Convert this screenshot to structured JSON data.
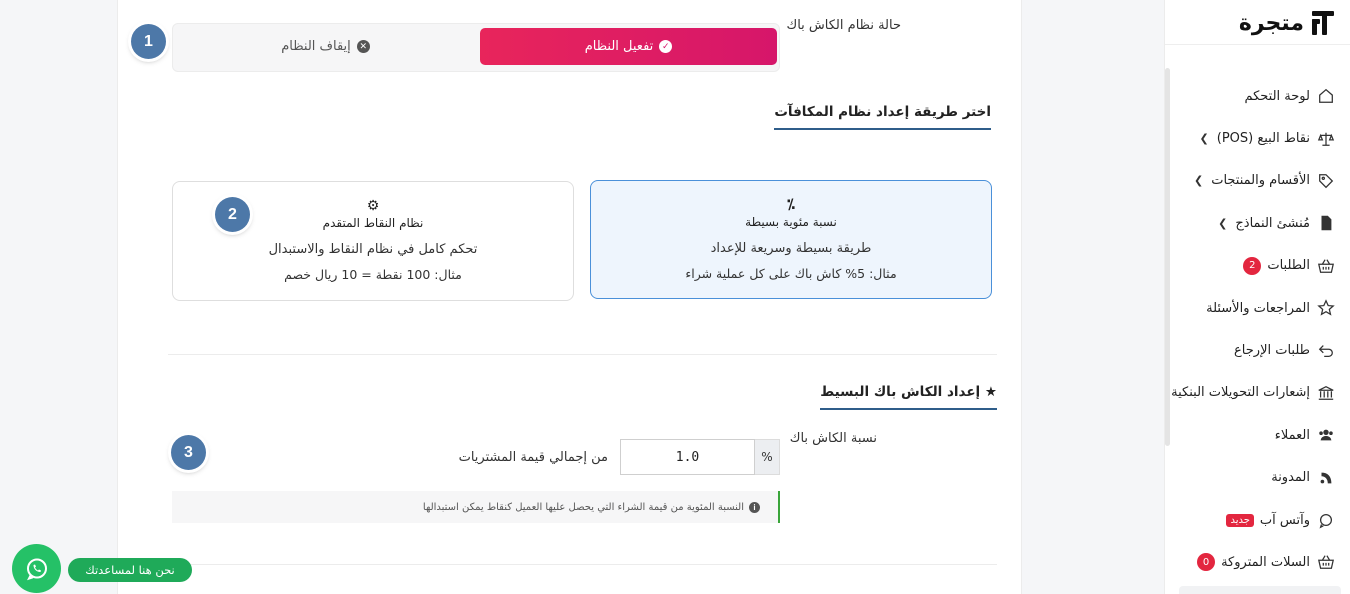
{
  "brand": {
    "logo_text": "متجرة"
  },
  "sidebar": {
    "items": [
      {
        "label": "لوحة التحكم",
        "icon": "home-icon"
      },
      {
        "label": "نقاط البيع (POS)",
        "icon": "scale-icon",
        "has_arrow": true
      },
      {
        "label": "الأقسام والمنتجات",
        "icon": "tag-icon",
        "has_arrow": true
      },
      {
        "label": "مُنشئ النماذج",
        "icon": "file-icon",
        "has_arrow": true
      },
      {
        "label": "الطلبات",
        "icon": "basket-icon",
        "badge": "2"
      },
      {
        "label": "المراجعات والأسئلة",
        "icon": "star-icon"
      },
      {
        "label": "طلبات الإرجاع",
        "icon": "return-icon"
      },
      {
        "label": "إشعارات التحويلات البنكية",
        "icon": "bank-icon"
      },
      {
        "label": "العملاء",
        "icon": "users-icon"
      },
      {
        "label": "المدونة",
        "icon": "blog-icon"
      },
      {
        "label": "وآتس آب",
        "icon": "whatsapp-icon",
        "tag": "جديد"
      },
      {
        "label": "السلات المتروكة",
        "icon": "basket-icon",
        "badge": "0"
      }
    ]
  },
  "status": {
    "label": "حالة نظام الكاش باك",
    "activate_label": "تفعيل النظام",
    "deactivate_label": "إيقاف النظام",
    "active": "activate"
  },
  "setup_method": {
    "title": "اختر طريقة إعداد نظام المكافآت",
    "options": [
      {
        "key": "simple",
        "icon": "percent-icon",
        "title": "نسبة مئوية بسيطة",
        "description": "طريقة بسيطة وسريعة للإعداد",
        "example": "مثال: 5% كاش باك على كل عملية شراء",
        "selected": true
      },
      {
        "key": "advanced",
        "icon": "gears-icon",
        "title": "نظام النقاط المتقدم",
        "description": "تحكم كامل في نظام النقاط والاستبدال",
        "example": "مثال: 100 نقطة = 10 ريال خصم",
        "selected": false
      }
    ]
  },
  "simple_setup": {
    "title": "إعداد الكاش باك البسيط",
    "rate_label": "نسبة الكاش باك",
    "rate_value": "1.0",
    "rate_suffix": "%",
    "rate_note": "من إجمالي قيمة المشتريات",
    "hint": "النسبة المئوية من قيمة الشراء التي يحصل عليها العميل كنقاط يمكن استبدالها"
  },
  "badges": [
    "1",
    "2",
    "3"
  ],
  "help": {
    "label": "نحن هنا لمساعدتك"
  },
  "colors": {
    "primary_gradient_start": "#e8255b",
    "primary_gradient_end": "#d6166a",
    "accent_blue": "#4a90d9",
    "badge_blue": "#4d78a8",
    "whatsapp_green": "#25c167"
  }
}
